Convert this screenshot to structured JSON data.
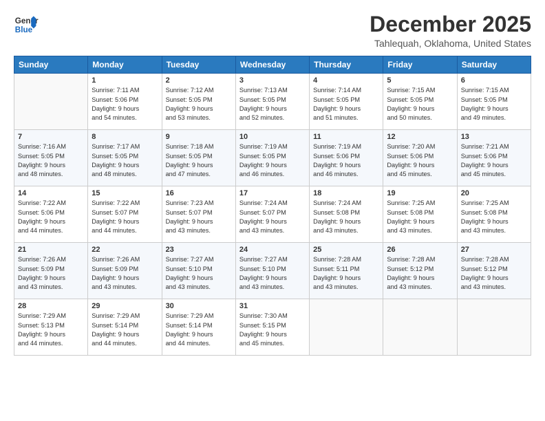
{
  "logo": {
    "general": "General",
    "blue": "Blue"
  },
  "header": {
    "month": "December 2025",
    "location": "Tahlequah, Oklahoma, United States"
  },
  "days_of_week": [
    "Sunday",
    "Monday",
    "Tuesday",
    "Wednesday",
    "Thursday",
    "Friday",
    "Saturday"
  ],
  "weeks": [
    [
      {
        "day": "",
        "info": ""
      },
      {
        "day": "1",
        "info": "Sunrise: 7:11 AM\nSunset: 5:06 PM\nDaylight: 9 hours\nand 54 minutes."
      },
      {
        "day": "2",
        "info": "Sunrise: 7:12 AM\nSunset: 5:05 PM\nDaylight: 9 hours\nand 53 minutes."
      },
      {
        "day": "3",
        "info": "Sunrise: 7:13 AM\nSunset: 5:05 PM\nDaylight: 9 hours\nand 52 minutes."
      },
      {
        "day": "4",
        "info": "Sunrise: 7:14 AM\nSunset: 5:05 PM\nDaylight: 9 hours\nand 51 minutes."
      },
      {
        "day": "5",
        "info": "Sunrise: 7:15 AM\nSunset: 5:05 PM\nDaylight: 9 hours\nand 50 minutes."
      },
      {
        "day": "6",
        "info": "Sunrise: 7:15 AM\nSunset: 5:05 PM\nDaylight: 9 hours\nand 49 minutes."
      }
    ],
    [
      {
        "day": "7",
        "info": "Sunrise: 7:16 AM\nSunset: 5:05 PM\nDaylight: 9 hours\nand 48 minutes."
      },
      {
        "day": "8",
        "info": "Sunrise: 7:17 AM\nSunset: 5:05 PM\nDaylight: 9 hours\nand 48 minutes."
      },
      {
        "day": "9",
        "info": "Sunrise: 7:18 AM\nSunset: 5:05 PM\nDaylight: 9 hours\nand 47 minutes."
      },
      {
        "day": "10",
        "info": "Sunrise: 7:19 AM\nSunset: 5:05 PM\nDaylight: 9 hours\nand 46 minutes."
      },
      {
        "day": "11",
        "info": "Sunrise: 7:19 AM\nSunset: 5:06 PM\nDaylight: 9 hours\nand 46 minutes."
      },
      {
        "day": "12",
        "info": "Sunrise: 7:20 AM\nSunset: 5:06 PM\nDaylight: 9 hours\nand 45 minutes."
      },
      {
        "day": "13",
        "info": "Sunrise: 7:21 AM\nSunset: 5:06 PM\nDaylight: 9 hours\nand 45 minutes."
      }
    ],
    [
      {
        "day": "14",
        "info": "Sunrise: 7:22 AM\nSunset: 5:06 PM\nDaylight: 9 hours\nand 44 minutes."
      },
      {
        "day": "15",
        "info": "Sunrise: 7:22 AM\nSunset: 5:07 PM\nDaylight: 9 hours\nand 44 minutes."
      },
      {
        "day": "16",
        "info": "Sunrise: 7:23 AM\nSunset: 5:07 PM\nDaylight: 9 hours\nand 43 minutes."
      },
      {
        "day": "17",
        "info": "Sunrise: 7:24 AM\nSunset: 5:07 PM\nDaylight: 9 hours\nand 43 minutes."
      },
      {
        "day": "18",
        "info": "Sunrise: 7:24 AM\nSunset: 5:08 PM\nDaylight: 9 hours\nand 43 minutes."
      },
      {
        "day": "19",
        "info": "Sunrise: 7:25 AM\nSunset: 5:08 PM\nDaylight: 9 hours\nand 43 minutes."
      },
      {
        "day": "20",
        "info": "Sunrise: 7:25 AM\nSunset: 5:08 PM\nDaylight: 9 hours\nand 43 minutes."
      }
    ],
    [
      {
        "day": "21",
        "info": "Sunrise: 7:26 AM\nSunset: 5:09 PM\nDaylight: 9 hours\nand 43 minutes."
      },
      {
        "day": "22",
        "info": "Sunrise: 7:26 AM\nSunset: 5:09 PM\nDaylight: 9 hours\nand 43 minutes."
      },
      {
        "day": "23",
        "info": "Sunrise: 7:27 AM\nSunset: 5:10 PM\nDaylight: 9 hours\nand 43 minutes."
      },
      {
        "day": "24",
        "info": "Sunrise: 7:27 AM\nSunset: 5:10 PM\nDaylight: 9 hours\nand 43 minutes."
      },
      {
        "day": "25",
        "info": "Sunrise: 7:28 AM\nSunset: 5:11 PM\nDaylight: 9 hours\nand 43 minutes."
      },
      {
        "day": "26",
        "info": "Sunrise: 7:28 AM\nSunset: 5:12 PM\nDaylight: 9 hours\nand 43 minutes."
      },
      {
        "day": "27",
        "info": "Sunrise: 7:28 AM\nSunset: 5:12 PM\nDaylight: 9 hours\nand 43 minutes."
      }
    ],
    [
      {
        "day": "28",
        "info": "Sunrise: 7:29 AM\nSunset: 5:13 PM\nDaylight: 9 hours\nand 44 minutes."
      },
      {
        "day": "29",
        "info": "Sunrise: 7:29 AM\nSunset: 5:14 PM\nDaylight: 9 hours\nand 44 minutes."
      },
      {
        "day": "30",
        "info": "Sunrise: 7:29 AM\nSunset: 5:14 PM\nDaylight: 9 hours\nand 44 minutes."
      },
      {
        "day": "31",
        "info": "Sunrise: 7:30 AM\nSunset: 5:15 PM\nDaylight: 9 hours\nand 45 minutes."
      },
      {
        "day": "",
        "info": ""
      },
      {
        "day": "",
        "info": ""
      },
      {
        "day": "",
        "info": ""
      }
    ]
  ]
}
